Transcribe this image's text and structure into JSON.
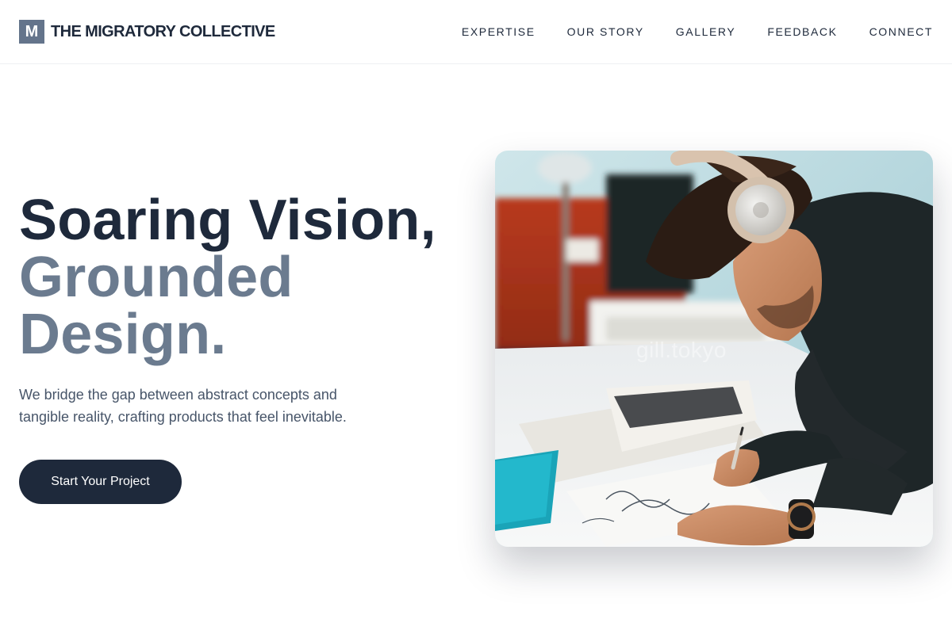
{
  "header": {
    "logo_letter": "M",
    "brand_name": "THE MIGRATORY COLLECTIVE",
    "nav": [
      {
        "label": "EXPERTISE"
      },
      {
        "label": "OUR STORY"
      },
      {
        "label": "GALLERY"
      },
      {
        "label": "FEEDBACK"
      },
      {
        "label": "CONNECT"
      }
    ]
  },
  "hero": {
    "title_line_1": "Soaring Vision,",
    "title_line_2": "Grounded",
    "title_line_3": "Design.",
    "subtitle": "We bridge the gap between abstract concepts and tangible reality, crafting products that feel inevitable.",
    "cta_label": "Start Your Project",
    "image_watermark": "gill.tokyo"
  },
  "colors": {
    "primary": "#1e293b",
    "muted": "#6b7b8f",
    "text_secondary": "#475569",
    "logo_bg": "#64748b"
  }
}
